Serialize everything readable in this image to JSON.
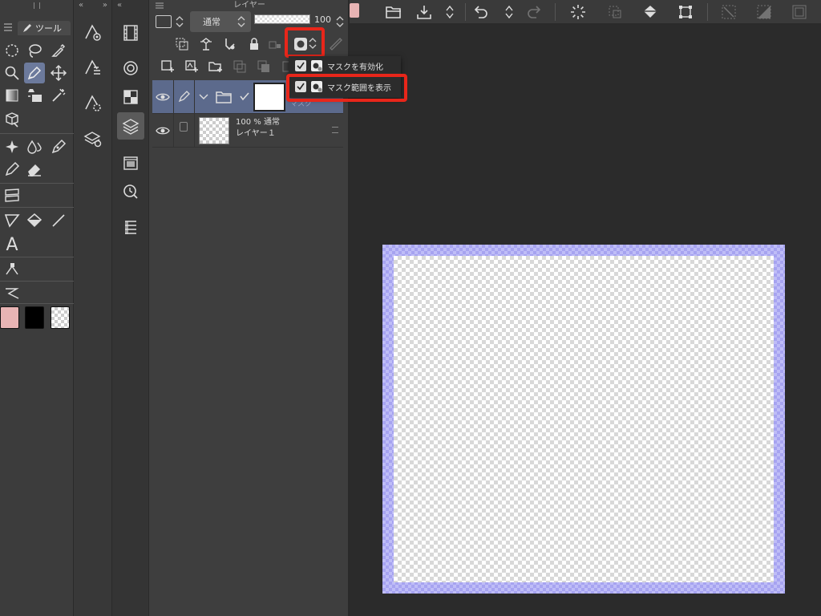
{
  "app": {
    "tool_panel": {
      "tab_label": "ツール",
      "tools": [
        "selection-tool",
        "lasso-tool",
        "eyedropper-tool",
        "zoom-tool",
        "pen-tool",
        "move-tool",
        "gradient-tool",
        "fill-tool",
        "auto-select-tool",
        "3d-tool",
        "sparkle-tool",
        "blend-tool",
        "g-pen-tool",
        "pencil-tool",
        "eraser-tool",
        "frame-tool",
        "shape-tool",
        "fill-bucket-tool",
        "line-tool",
        "text-tool",
        "vector-tool",
        "correct-line-tool"
      ],
      "text_tool_glyph": "A",
      "colors": {
        "main": "#e8b4b4",
        "sub": "#000000"
      }
    },
    "sub_column": {
      "left_arrows": "«",
      "right_arrows": "»"
    },
    "layer_panel": {
      "title": "レイヤー",
      "blend_mode": "通常",
      "opacity": "100",
      "layers": [
        {
          "name": "",
          "type": "folder",
          "selected": true,
          "hidden_label": "マスク"
        },
        {
          "line1": "100 %  通常",
          "line2": "レイヤー１",
          "selected": false
        }
      ]
    },
    "dropdown": {
      "items": [
        {
          "label": "マスクを有効化",
          "checked": true
        },
        {
          "label": "マスク範囲を表示",
          "checked": true
        }
      ]
    },
    "highlight_color": "#e8261a",
    "mask_color": "#a6a3f0"
  }
}
